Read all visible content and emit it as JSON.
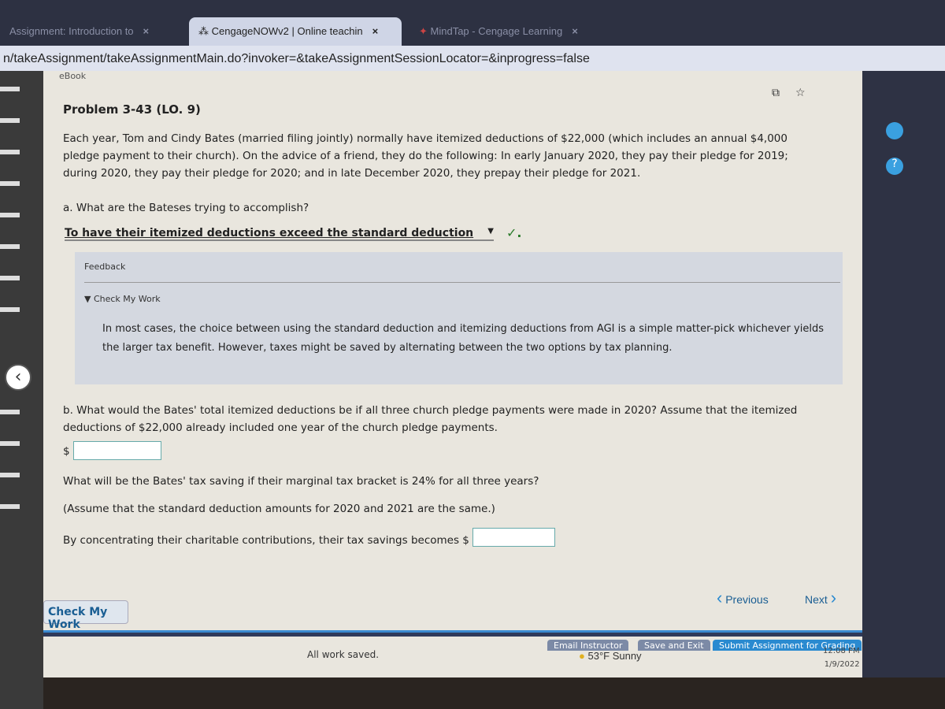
{
  "browser": {
    "tabs": [
      {
        "label": "Assignment: Introduction to",
        "active": false
      },
      {
        "label": "CengageNOWv2 | Online teachin",
        "active": true
      },
      {
        "label": "MindTap - Cengage Learning",
        "active": false
      }
    ],
    "address": "n/takeAssignment/takeAssignmentMain.do?invoker=&takeAssignmentSessionLocator=&inprogress=false"
  },
  "page": {
    "ebook": "eBook",
    "title": "Problem 3-43 (LO. 9)",
    "intro": "Each year, Tom and Cindy Bates (married filing jointly) normally have itemized deductions of $22,000 (which includes an annual $4,000 pledge payment to their church). On the advice of a friend, they do the following: In early January 2020, they pay their pledge for 2019; during 2020, they pay their pledge for 2020; and in late December 2020, they prepay their pledge for 2021.",
    "qa": "a.  What are the Bateses trying to accomplish?",
    "qa_answer": "To have their itemized deductions exceed the standard deduction",
    "qa_check": "✓.",
    "feedback_label": "Feedback",
    "check_my_work_label": "▼ Check My Work",
    "feedback_text": "In most cases, the choice between using the standard deduction and itemizing deductions from AGI is a simple matter-pick whichever yields the larger tax benefit. However, taxes might be saved by alternating between the two options by tax planning.",
    "qb": "b.  What would the Bates' total itemized deductions be if all three church pledge payments were made in 2020? Assume that the itemized deductions of $22,000 already included one year of the church pledge payments.",
    "dollar": "$",
    "qb_value": "",
    "q2": "What will be the Bates' tax saving if their marginal tax bracket is 24% for all three years?",
    "q2_note": "(Assume that the standard deduction amounts for 2020 and 2021 are the same.)",
    "q2_prompt": "By concentrating their charitable contributions, their tax savings becomes $",
    "q2_value": "",
    "previous": "Previous",
    "next": "Next",
    "check_button": "Check My Work",
    "email": "Email Instructor",
    "save_exit": "Save and Exit",
    "submit": "Submit Assignment for Grading",
    "saved": "All work saved."
  },
  "taskbar": {
    "weather": "53°F  Sunny",
    "time": "12:08 PM",
    "date": "1/9/2022"
  }
}
